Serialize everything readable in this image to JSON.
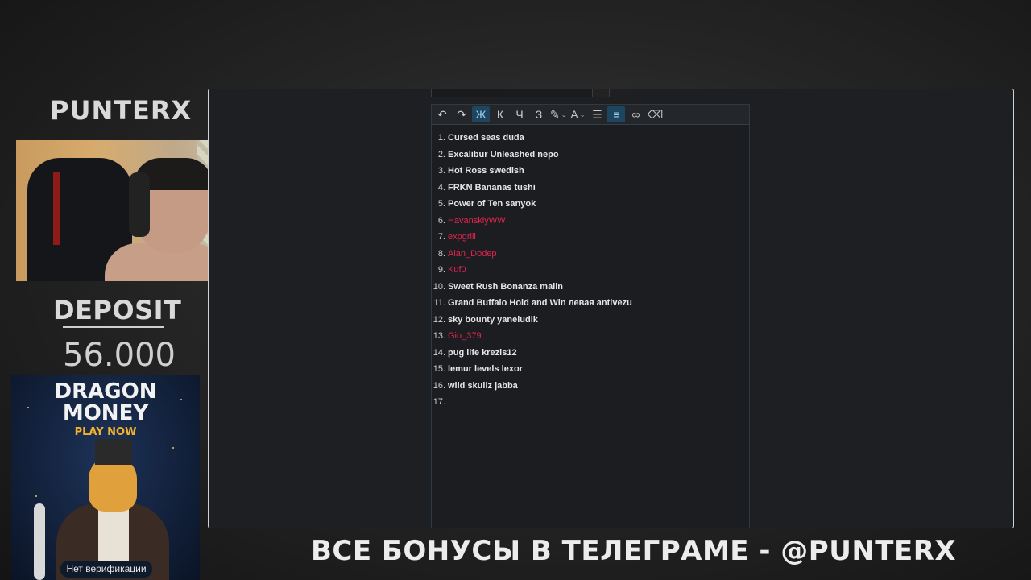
{
  "overlay": {
    "brand": "PUNTERX",
    "deposit_label": "DEPOSIT",
    "deposit_value": "56.000",
    "footer": "ВСЕ БОНУСЫ В ТЕЛЕГРАМЕ - @PUNTERX"
  },
  "ad": {
    "title_line1": "DRAGON",
    "title_line2": "MONEY",
    "cta": "PLAY NOW",
    "badge": "Нет верификации"
  },
  "editor": {
    "toolbar": [
      {
        "name": "undo-icon",
        "glyph": "↶"
      },
      {
        "name": "redo-icon",
        "glyph": "↷"
      },
      {
        "name": "bold-button",
        "glyph": "Ж"
      },
      {
        "name": "italic-button",
        "glyph": "К"
      },
      {
        "name": "underline-button",
        "glyph": "Ч"
      },
      {
        "name": "strikethrough-button",
        "glyph": "З"
      },
      {
        "name": "highlight-icon",
        "glyph": "✎"
      },
      {
        "name": "font-color-icon",
        "glyph": "A"
      },
      {
        "name": "bullet-list-icon",
        "glyph": "☰"
      },
      {
        "name": "numbered-list-icon",
        "glyph": "≡"
      },
      {
        "name": "link-icon",
        "glyph": "∞"
      },
      {
        "name": "eraser-icon",
        "glyph": "⌫"
      }
    ],
    "items": [
      {
        "num": "1.",
        "text": "Cursed seas duda",
        "color": "white"
      },
      {
        "num": "2.",
        "text": "Excalibur Unleashed nepo",
        "color": "white"
      },
      {
        "num": "3.",
        "text": "Hot Ross swedish",
        "color": "white"
      },
      {
        "num": "4.",
        "text": "FRKN Bananas tushi",
        "color": "white"
      },
      {
        "num": "5.",
        "text": "Power of Ten sanyok",
        "color": "white"
      },
      {
        "num": "6.",
        "text": "HavanskiyWW",
        "color": "red"
      },
      {
        "num": "7.",
        "text": "expgrill",
        "color": "red"
      },
      {
        "num": "8.",
        "text": "Alan_Dodep",
        "color": "red"
      },
      {
        "num": "9.",
        "text": "Kuf0",
        "color": "red"
      },
      {
        "num": "10.",
        "text": "Sweet Rush Bonanza malin",
        "color": "white"
      },
      {
        "num": "11.",
        "text": "Grand Buffalo Hold and Win левая antivezu",
        "color": "white"
      },
      {
        "num": "12.",
        "text": "sky bounty yaneludik",
        "color": "white"
      },
      {
        "num": "13.",
        "text": "Gio_379",
        "color": "red"
      },
      {
        "num": "14.",
        "text": "pug life krezis12",
        "color": "white"
      },
      {
        "num": "15.",
        "text": "lemur levels lexor",
        "color": "white"
      },
      {
        "num": "16.",
        "text": "wild skullz jabba",
        "color": "white"
      },
      {
        "num": "17.",
        "text": "",
        "color": "white"
      }
    ]
  }
}
